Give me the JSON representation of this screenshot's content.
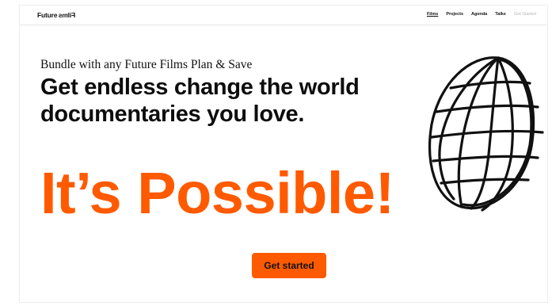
{
  "header": {
    "logo_text": "Future",
    "logo_mirrored": "Films",
    "nav": [
      {
        "label": "Films"
      },
      {
        "label": "Projects"
      },
      {
        "label": "Agenda"
      },
      {
        "label": "Talks"
      },
      {
        "label": "Get Started"
      }
    ]
  },
  "hero": {
    "subhead": "Bundle with any Future Films Plan & Save",
    "headline_line1": "Get endless change the world",
    "headline_line2": "documentaries you love.",
    "big_text": "It’s Possible!",
    "cta_label": "Get started"
  },
  "colors": {
    "accent": "#ff5a00",
    "text": "#111111"
  },
  "icons": {
    "illustration": "globe-sketch-icon"
  }
}
